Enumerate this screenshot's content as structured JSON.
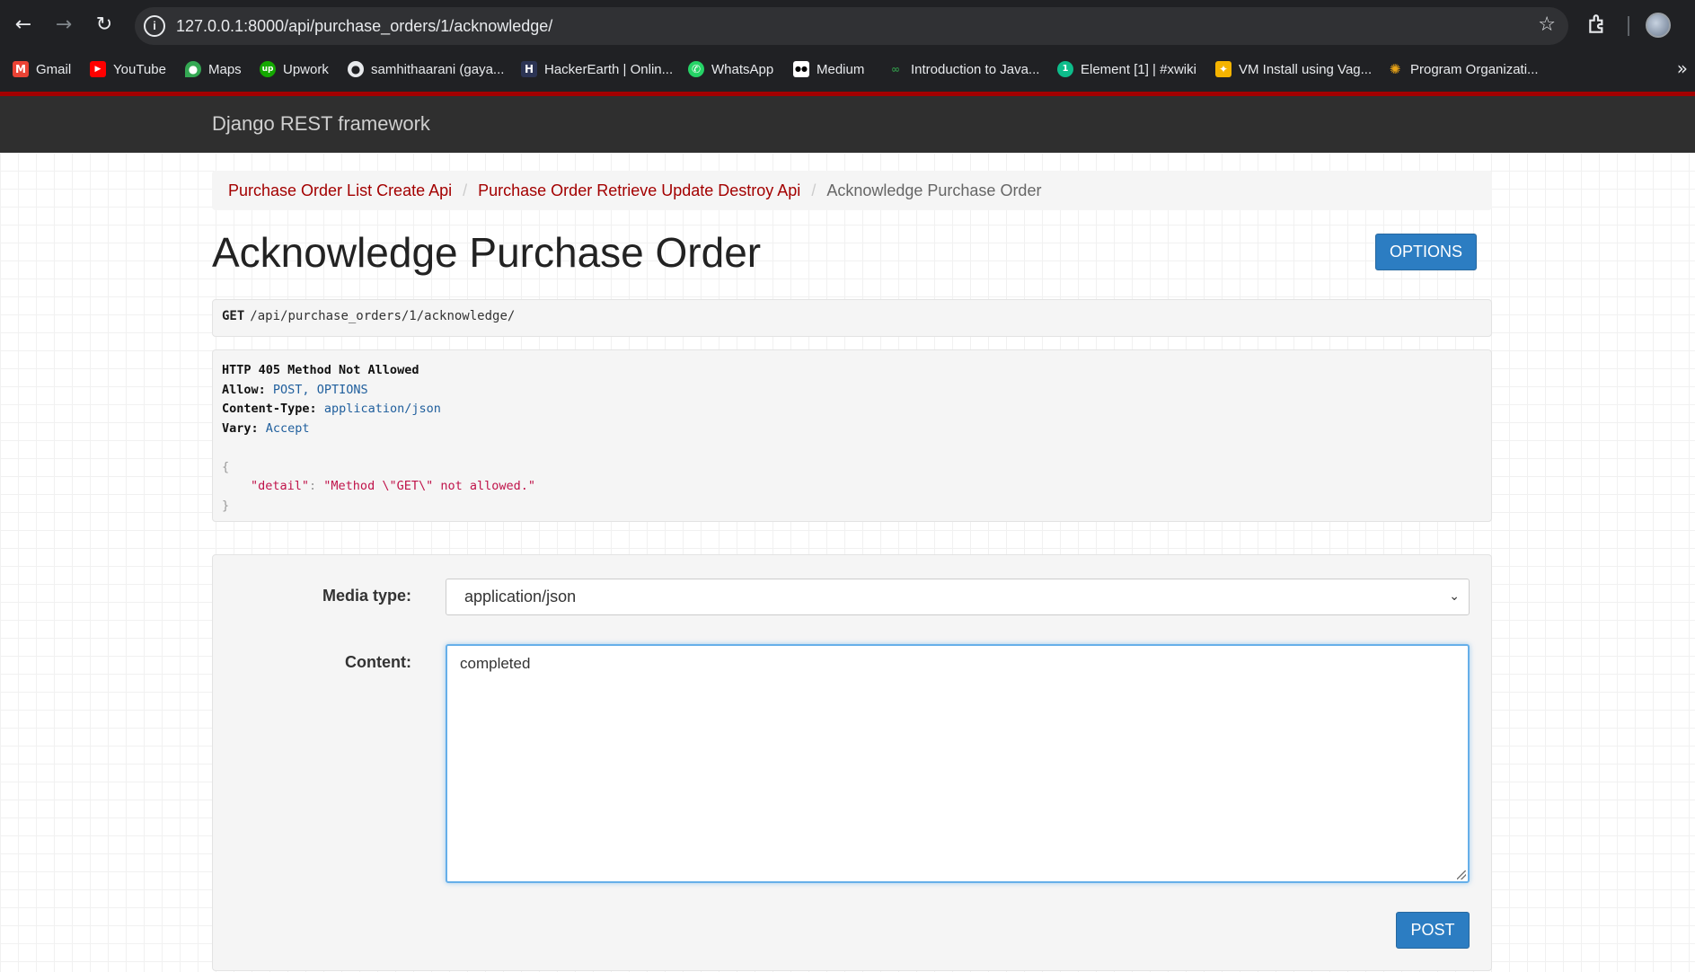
{
  "browser": {
    "url": "127.0.0.1:8000/api/purchase_orders/1/acknowledge/",
    "back_icon": "←",
    "forward_icon": "→",
    "reload_icon": "↻",
    "info_icon": "i",
    "star_icon": "☆",
    "bookmarks": [
      {
        "label": "Gmail",
        "icon": "M",
        "color": "#ea4335"
      },
      {
        "label": "YouTube",
        "icon": "▶",
        "color": "#ff0000"
      },
      {
        "label": "Maps",
        "icon": "●",
        "color": "#34a853"
      },
      {
        "label": "Upwork",
        "icon": "up",
        "color": "#14a800"
      },
      {
        "label": "samhithaarani (gaya...",
        "icon": "●",
        "color": "#444444"
      },
      {
        "label": "HackerEarth | Onlin...",
        "icon": "H",
        "color": "#2c3454"
      },
      {
        "label": "WhatsApp",
        "icon": "✆",
        "color": "#25d366"
      },
      {
        "label": "Medium",
        "icon": "●●",
        "color": "#000000"
      },
      {
        "label": "Introduction to Java...",
        "icon": "∞",
        "color": "#2f8d46"
      },
      {
        "label": "Element [1] | #xwiki",
        "icon": "1",
        "color": "#0dbd8b"
      },
      {
        "label": "VM Install using Vag...",
        "icon": "✦",
        "color": "#f5b400"
      },
      {
        "label": "Program Organizati...",
        "icon": "✺",
        "color": "#e8a317"
      }
    ],
    "more_icon": "»"
  },
  "navbar": {
    "brand": "Django REST framework"
  },
  "breadcrumb": {
    "items": [
      "Purchase Order List Create Api",
      "Purchase Order Retrieve Update Destroy Api"
    ],
    "active": "Acknowledge Purchase Order",
    "separator": "/"
  },
  "page": {
    "title": "Acknowledge Purchase Order",
    "options_label": "OPTIONS"
  },
  "request": {
    "method": "GET",
    "path": "/api/purchase_orders/1/acknowledge/"
  },
  "response": {
    "status": "HTTP 405 Method Not Allowed",
    "headers": [
      {
        "name": "Allow:",
        "value": "POST, OPTIONS"
      },
      {
        "name": "Content-Type:",
        "value": "application/json"
      },
      {
        "name": "Vary:",
        "value": "Accept"
      }
    ],
    "open_brace": "{",
    "key": "\"detail\"",
    "colon": ": ",
    "value": "\"Method \\\"GET\\\" not allowed.\"",
    "close_brace": "}"
  },
  "form": {
    "media_type_label": "Media type:",
    "media_type_value": "application/json",
    "content_label": "Content:",
    "content_value": "completed",
    "post_label": "POST"
  }
}
